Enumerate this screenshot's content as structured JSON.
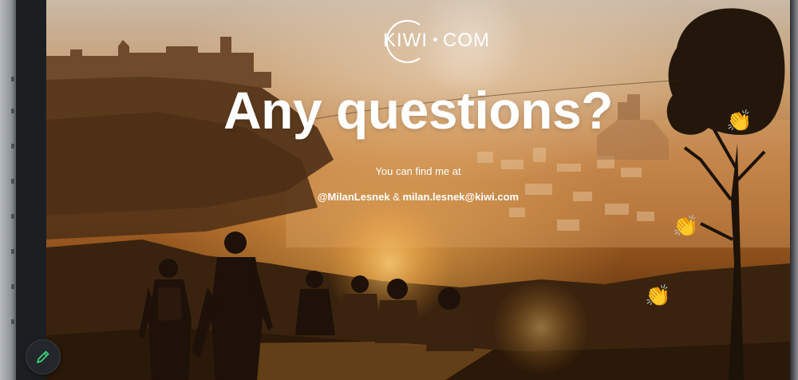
{
  "slide": {
    "logo_left": "KIWI",
    "logo_right": "COM",
    "headline": "Any questions?",
    "subtitle": "You can find me at",
    "contact_handle": "@MilanLesnek",
    "contact_separator": " & ",
    "contact_email": "milan.lesnek@kiwi.com"
  },
  "reactions": [
    {
      "emoji": "👏"
    },
    {
      "emoji": "👏"
    },
    {
      "emoji": "👏"
    }
  ],
  "toolbar": {
    "pen_icon": "pencil-icon"
  },
  "colors": {
    "accent_pen": "#3ccf7a",
    "text": "#ffffff"
  }
}
